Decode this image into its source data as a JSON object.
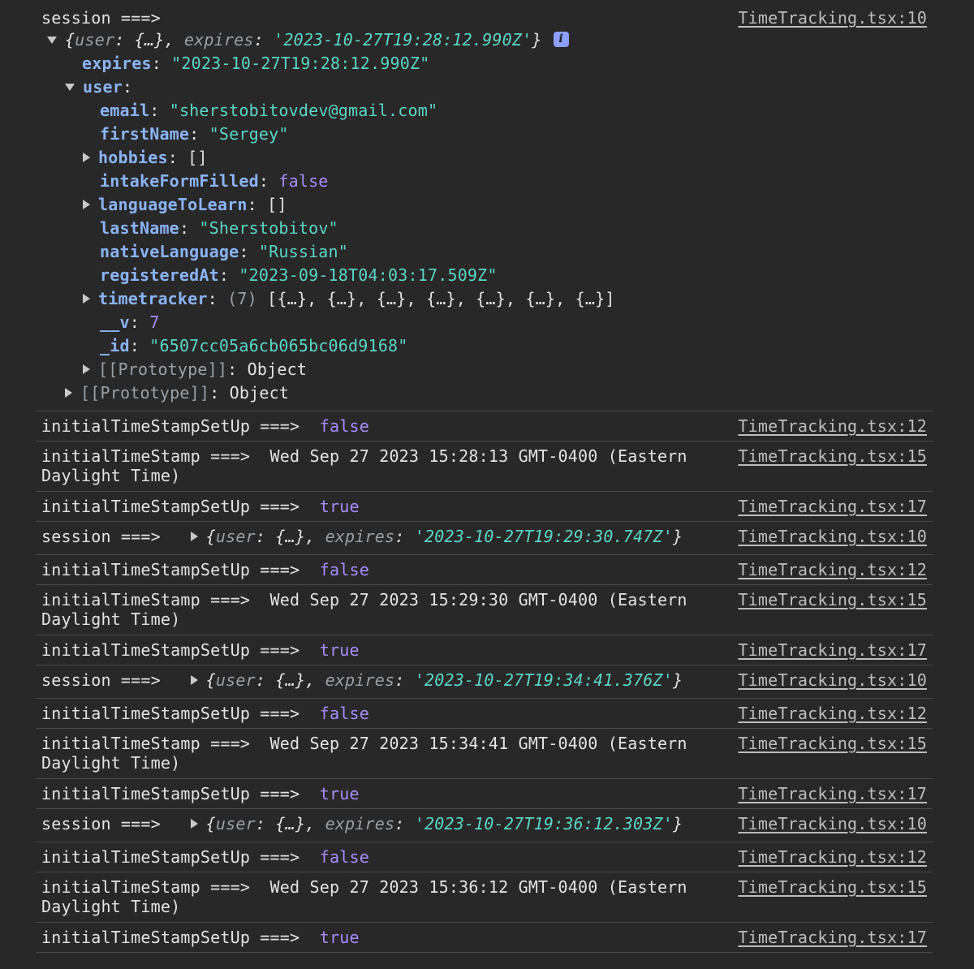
{
  "source_files": {
    "l10": "TimeTracking.tsx:10",
    "l12": "TimeTracking.tsx:12",
    "l15": "TimeTracking.tsx:15",
    "l17": "TimeTracking.tsx:17"
  },
  "labels": {
    "session": "session ===>",
    "setup": "initialTimeStampSetUp ===>",
    "stamp": "initialTimeStamp ===>",
    "user_key": "user",
    "expires_key": "expires",
    "ellipsis_obj": "{…}"
  },
  "first_session": {
    "summary_expires": "'2023-10-27T19:28:12.990Z'",
    "expires_value": "\"2023-10-27T19:28:12.990Z\"",
    "user": {
      "email_key": "email",
      "email": "\"sherstobitovdev@gmail.com\"",
      "firstName_key": "firstName",
      "firstName": "\"Sergey\"",
      "hobbies_key": "hobbies",
      "hobbies": "[]",
      "intakeFormFilled_key": "intakeFormFilled",
      "intakeFormFilled": "false",
      "languageToLearn_key": "languageToLearn",
      "languageToLearn": "[]",
      "lastName_key": "lastName",
      "lastName": "\"Sherstobitov\"",
      "nativeLanguage_key": "nativeLanguage",
      "nativeLanguage": "\"Russian\"",
      "registeredAt_key": "registeredAt",
      "registeredAt": "\"2023-09-18T04:03:17.509Z\"",
      "timetracker_key": "timetracker",
      "timetracker_count": "(7)",
      "timetracker_preview": "[{…}, {…}, {…}, {…}, {…}, {…}, {…}]",
      "v_key": "__v",
      "v": "7",
      "id_key": "_id",
      "id": "\"6507cc05a6cb065bc06d9168\"",
      "prototype": "[[Prototype]]",
      "prototype_value": "Object"
    },
    "prototype": "[[Prototype]]",
    "prototype_value": "Object"
  },
  "log_entries": [
    {
      "kind": "setup",
      "value": "false",
      "src": "TimeTracking.tsx:12"
    },
    {
      "kind": "stamp",
      "value": "Wed Sep 27 2023 15:28:13 GMT-0400 (Eastern\nDaylight Time)",
      "src": "TimeTracking.tsx:15"
    },
    {
      "kind": "setup",
      "value": "true",
      "src": "TimeTracking.tsx:17"
    },
    {
      "kind": "session",
      "value": "'2023-10-27T19:29:30.747Z'",
      "src": "TimeTracking.tsx:10"
    },
    {
      "kind": "setup",
      "value": "false",
      "src": "TimeTracking.tsx:12"
    },
    {
      "kind": "stamp",
      "value": "Wed Sep 27 2023 15:29:30 GMT-0400 (Eastern\nDaylight Time)",
      "src": "TimeTracking.tsx:15"
    },
    {
      "kind": "setup",
      "value": "true",
      "src": "TimeTracking.tsx:17"
    },
    {
      "kind": "session",
      "value": "'2023-10-27T19:34:41.376Z'",
      "src": "TimeTracking.tsx:10"
    },
    {
      "kind": "setup",
      "value": "false",
      "src": "TimeTracking.tsx:12"
    },
    {
      "kind": "stamp",
      "value": "Wed Sep 27 2023 15:34:41 GMT-0400 (Eastern\nDaylight Time)",
      "src": "TimeTracking.tsx:15"
    },
    {
      "kind": "setup",
      "value": "true",
      "src": "TimeTracking.tsx:17"
    },
    {
      "kind": "session",
      "value": "'2023-10-27T19:36:12.303Z'",
      "src": "TimeTracking.tsx:10"
    },
    {
      "kind": "setup",
      "value": "false",
      "src": "TimeTracking.tsx:12"
    },
    {
      "kind": "stamp",
      "value": "Wed Sep 27 2023 15:36:12 GMT-0400 (Eastern\nDaylight Time)",
      "src": "TimeTracking.tsx:15"
    },
    {
      "kind": "setup",
      "value": "true",
      "src": "TimeTracking.tsx:17"
    }
  ],
  "colors": {
    "background": "#282828",
    "key": "#8ab4f8",
    "string": "#5cd5c5",
    "boolean": "#a88bfa",
    "separator": "#4a4a4a"
  },
  "icons": {
    "expand": "triangle-right-icon",
    "collapse": "triangle-down-icon",
    "info": "info-icon"
  }
}
